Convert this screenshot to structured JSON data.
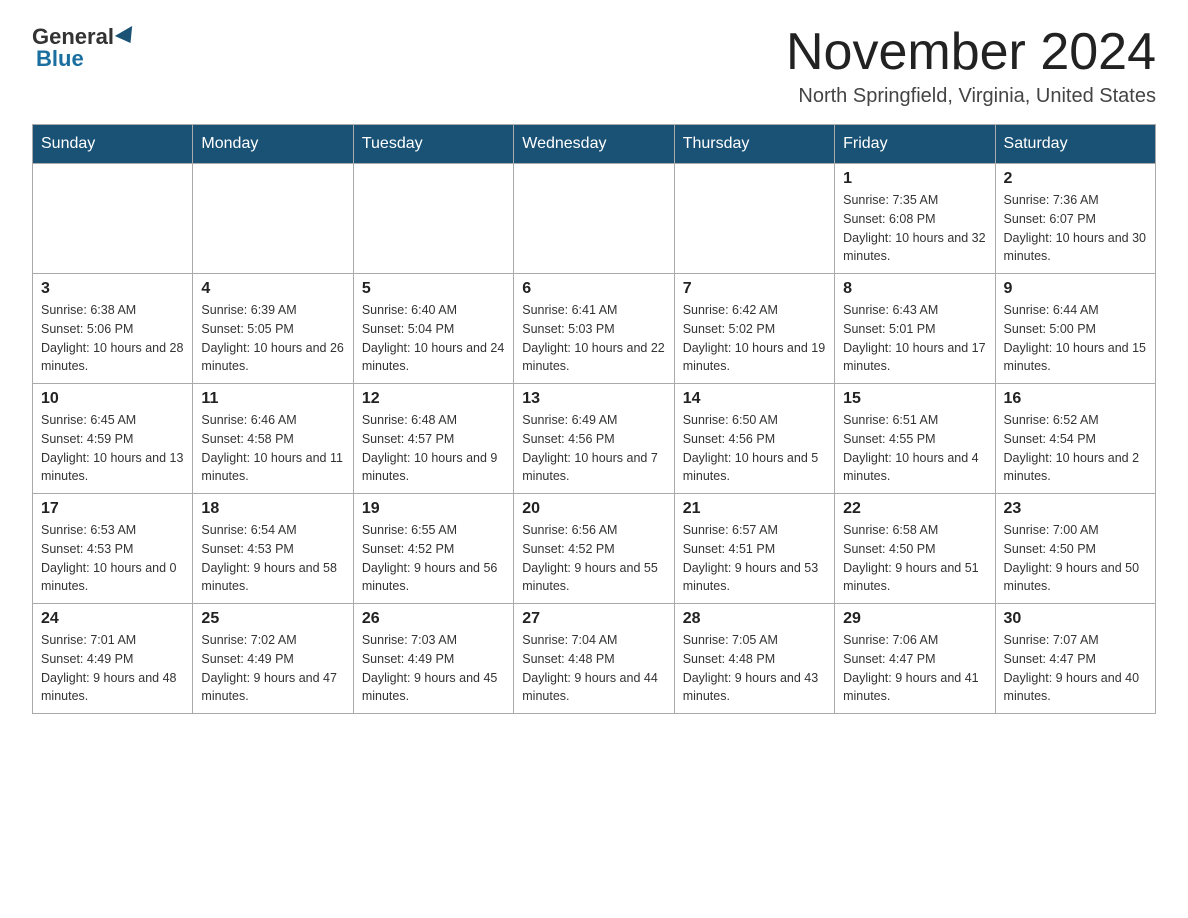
{
  "header": {
    "logo_general": "General",
    "logo_blue": "Blue",
    "month_title": "November 2024",
    "location": "North Springfield, Virginia, United States"
  },
  "days_of_week": [
    "Sunday",
    "Monday",
    "Tuesday",
    "Wednesday",
    "Thursday",
    "Friday",
    "Saturday"
  ],
  "weeks": [
    [
      {
        "day": "",
        "info": ""
      },
      {
        "day": "",
        "info": ""
      },
      {
        "day": "",
        "info": ""
      },
      {
        "day": "",
        "info": ""
      },
      {
        "day": "",
        "info": ""
      },
      {
        "day": "1",
        "info": "Sunrise: 7:35 AM\nSunset: 6:08 PM\nDaylight: 10 hours and 32 minutes."
      },
      {
        "day": "2",
        "info": "Sunrise: 7:36 AM\nSunset: 6:07 PM\nDaylight: 10 hours and 30 minutes."
      }
    ],
    [
      {
        "day": "3",
        "info": "Sunrise: 6:38 AM\nSunset: 5:06 PM\nDaylight: 10 hours and 28 minutes."
      },
      {
        "day": "4",
        "info": "Sunrise: 6:39 AM\nSunset: 5:05 PM\nDaylight: 10 hours and 26 minutes."
      },
      {
        "day": "5",
        "info": "Sunrise: 6:40 AM\nSunset: 5:04 PM\nDaylight: 10 hours and 24 minutes."
      },
      {
        "day": "6",
        "info": "Sunrise: 6:41 AM\nSunset: 5:03 PM\nDaylight: 10 hours and 22 minutes."
      },
      {
        "day": "7",
        "info": "Sunrise: 6:42 AM\nSunset: 5:02 PM\nDaylight: 10 hours and 19 minutes."
      },
      {
        "day": "8",
        "info": "Sunrise: 6:43 AM\nSunset: 5:01 PM\nDaylight: 10 hours and 17 minutes."
      },
      {
        "day": "9",
        "info": "Sunrise: 6:44 AM\nSunset: 5:00 PM\nDaylight: 10 hours and 15 minutes."
      }
    ],
    [
      {
        "day": "10",
        "info": "Sunrise: 6:45 AM\nSunset: 4:59 PM\nDaylight: 10 hours and 13 minutes."
      },
      {
        "day": "11",
        "info": "Sunrise: 6:46 AM\nSunset: 4:58 PM\nDaylight: 10 hours and 11 minutes."
      },
      {
        "day": "12",
        "info": "Sunrise: 6:48 AM\nSunset: 4:57 PM\nDaylight: 10 hours and 9 minutes."
      },
      {
        "day": "13",
        "info": "Sunrise: 6:49 AM\nSunset: 4:56 PM\nDaylight: 10 hours and 7 minutes."
      },
      {
        "day": "14",
        "info": "Sunrise: 6:50 AM\nSunset: 4:56 PM\nDaylight: 10 hours and 5 minutes."
      },
      {
        "day": "15",
        "info": "Sunrise: 6:51 AM\nSunset: 4:55 PM\nDaylight: 10 hours and 4 minutes."
      },
      {
        "day": "16",
        "info": "Sunrise: 6:52 AM\nSunset: 4:54 PM\nDaylight: 10 hours and 2 minutes."
      }
    ],
    [
      {
        "day": "17",
        "info": "Sunrise: 6:53 AM\nSunset: 4:53 PM\nDaylight: 10 hours and 0 minutes."
      },
      {
        "day": "18",
        "info": "Sunrise: 6:54 AM\nSunset: 4:53 PM\nDaylight: 9 hours and 58 minutes."
      },
      {
        "day": "19",
        "info": "Sunrise: 6:55 AM\nSunset: 4:52 PM\nDaylight: 9 hours and 56 minutes."
      },
      {
        "day": "20",
        "info": "Sunrise: 6:56 AM\nSunset: 4:52 PM\nDaylight: 9 hours and 55 minutes."
      },
      {
        "day": "21",
        "info": "Sunrise: 6:57 AM\nSunset: 4:51 PM\nDaylight: 9 hours and 53 minutes."
      },
      {
        "day": "22",
        "info": "Sunrise: 6:58 AM\nSunset: 4:50 PM\nDaylight: 9 hours and 51 minutes."
      },
      {
        "day": "23",
        "info": "Sunrise: 7:00 AM\nSunset: 4:50 PM\nDaylight: 9 hours and 50 minutes."
      }
    ],
    [
      {
        "day": "24",
        "info": "Sunrise: 7:01 AM\nSunset: 4:49 PM\nDaylight: 9 hours and 48 minutes."
      },
      {
        "day": "25",
        "info": "Sunrise: 7:02 AM\nSunset: 4:49 PM\nDaylight: 9 hours and 47 minutes."
      },
      {
        "day": "26",
        "info": "Sunrise: 7:03 AM\nSunset: 4:49 PM\nDaylight: 9 hours and 45 minutes."
      },
      {
        "day": "27",
        "info": "Sunrise: 7:04 AM\nSunset: 4:48 PM\nDaylight: 9 hours and 44 minutes."
      },
      {
        "day": "28",
        "info": "Sunrise: 7:05 AM\nSunset: 4:48 PM\nDaylight: 9 hours and 43 minutes."
      },
      {
        "day": "29",
        "info": "Sunrise: 7:06 AM\nSunset: 4:47 PM\nDaylight: 9 hours and 41 minutes."
      },
      {
        "day": "30",
        "info": "Sunrise: 7:07 AM\nSunset: 4:47 PM\nDaylight: 9 hours and 40 minutes."
      }
    ]
  ]
}
